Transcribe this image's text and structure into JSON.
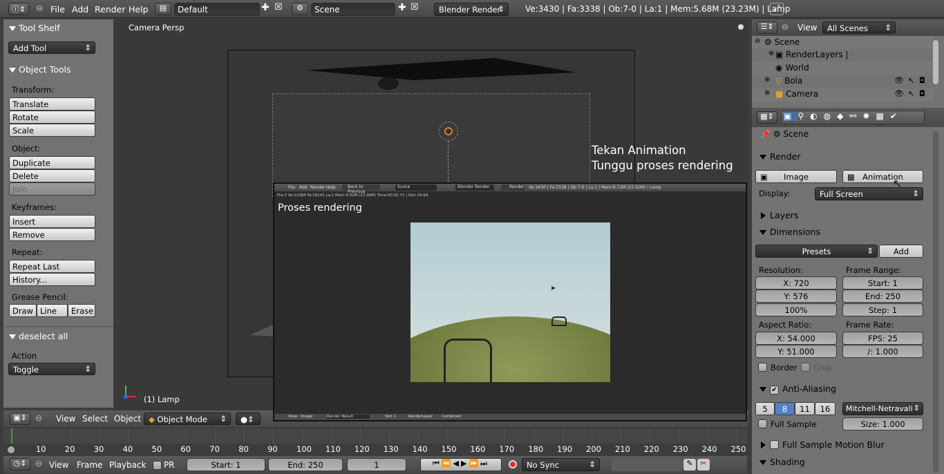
{
  "topbar": {
    "menu": [
      "File",
      "Add",
      "Render",
      "Help"
    ],
    "screen_layout": "Default",
    "scene": "Scene",
    "render_engine": "Blender Render",
    "stats": "Ve:3430 | Fa:3338 | Ob:7-0 | La:1 | Mem:5.68M (23.23M) | Lamp"
  },
  "tool_shelf": {
    "title": "Tool Shelf",
    "add_tool": "Add Tool",
    "object_tools_title": "Object Tools",
    "transform_label": "Transform:",
    "translate": "Translate",
    "rotate": "Rotate",
    "scale": "Scale",
    "object_label": "Object:",
    "duplicate": "Duplicate",
    "delete": "Delete",
    "join": "Join",
    "keyframes_label": "Keyframes:",
    "insert": "Insert",
    "remove": "Remove",
    "repeat_label": "Repeat:",
    "repeat_last": "Repeat Last",
    "history": "History...",
    "grease_label": "Grease Pencil:",
    "draw": "Draw",
    "line": "Line",
    "erase": "Erase",
    "operator_title": "deselect all",
    "action_label": "Action",
    "action_value": "Toggle"
  },
  "viewport": {
    "view_name": "Camera Persp",
    "object_label": "(1) Lamp",
    "annotation_line1": "Tekan Animation",
    "annotation_line2": "Tunggu proses rendering",
    "header_menu": [
      "View",
      "Select",
      "Object"
    ],
    "mode": "Object Mode"
  },
  "render_window": {
    "title_overlay": "Proses rendering",
    "menu": [
      "File",
      "Add",
      "Render",
      "Help"
    ],
    "back_button": "Back to Previous",
    "scene": "Scene",
    "engine": "Blender Render",
    "render_label": "Render",
    "stats": "Ve:3430 | Fa:3338 | Ob:7-0 | La:1 | Mem:9.72M (23.50M) | Lamp",
    "info_line": "Fra:2  Ve:12384 Fa:18141 La:1 Mem:9.42M (23.36M) Time:00:02.71 | Part 24-64",
    "footer_items": [
      "View",
      "Image",
      "Render Result",
      "Slot 1",
      "RenderLayer",
      "Combined"
    ]
  },
  "outliner": {
    "view": "View",
    "filter": "All Scenes",
    "items": [
      "Scene",
      "RenderLayers",
      "World",
      "Bola",
      "Camera"
    ]
  },
  "properties": {
    "context": "Scene",
    "render_title": "Render",
    "image_btn": "Image",
    "animation_btn": "Animation",
    "display_label": "Display:",
    "display_value": "Full Screen",
    "layers_title": "Layers",
    "dimensions_title": "Dimensions",
    "presets": "Presets",
    "add": "Add",
    "resolution_label": "Resolution:",
    "res_x": "X: 720",
    "res_y": "Y: 576",
    "res_pct": "100%",
    "frame_range_label": "Frame Range:",
    "start": "Start: 1",
    "end": "End: 250",
    "step": "Step: 1",
    "aspect_label": "Aspect Ratio:",
    "aspect_x": "X: 54.000",
    "aspect_y": "Y: 51.000",
    "frame_rate_label": "Frame Rate:",
    "fps": "FPS: 25",
    "fps_base": "/: 1.000",
    "border": "Border",
    "crop": "Crop",
    "aa_title": "Anti-Aliasing",
    "aa_samples": [
      "5",
      "8",
      "11",
      "16"
    ],
    "aa_selected": "8",
    "aa_filter": "Mitchell-Netravali",
    "full_sample": "Full Sample",
    "size": "Size: 1.000",
    "fsmb_title": "Full Sample Motion Blur",
    "shading_title": "Shading"
  },
  "timeline": {
    "ticks": [
      "0",
      "10",
      "20",
      "30",
      "40",
      "50",
      "60",
      "70",
      "80",
      "90",
      "100",
      "110",
      "120",
      "130",
      "140",
      "150",
      "160",
      "170",
      "180",
      "190",
      "200",
      "210",
      "220",
      "230",
      "240",
      "250"
    ],
    "menu": [
      "View",
      "Frame",
      "Playback"
    ],
    "pr": "PR",
    "start": "Start: 1",
    "end": "End: 250",
    "current": "1",
    "sync": "No Sync"
  }
}
